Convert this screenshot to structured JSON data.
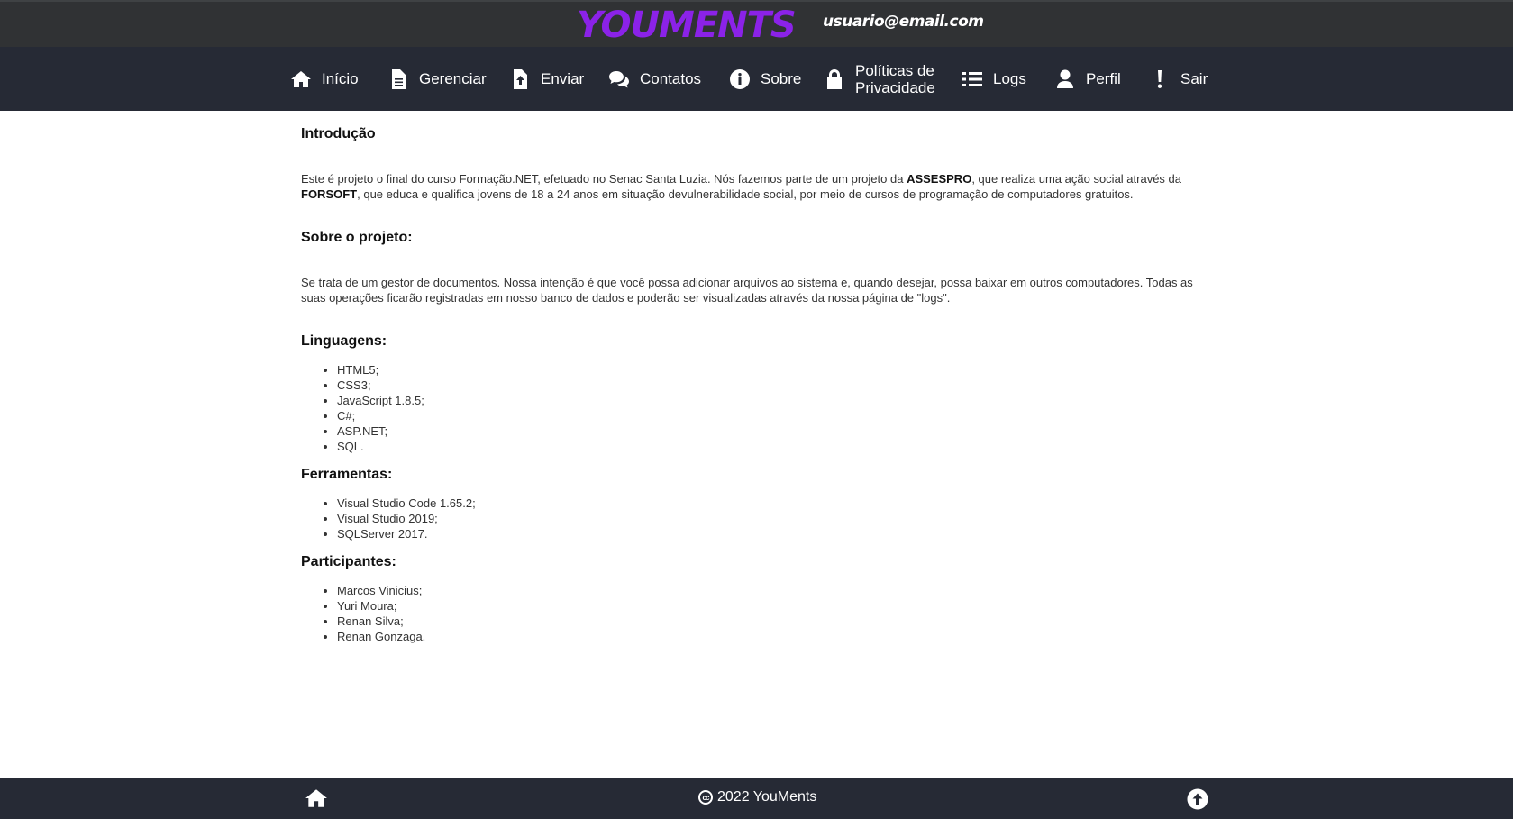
{
  "header": {
    "logo": "YOUMENTS",
    "user_email": "usuario@email.com"
  },
  "nav": {
    "items": [
      {
        "label": "Início",
        "icon": "home-icon"
      },
      {
        "label": "Gerenciar",
        "icon": "file-icon"
      },
      {
        "label": "Enviar",
        "icon": "upload-file-icon"
      },
      {
        "label": "Contatos",
        "icon": "comments-icon"
      },
      {
        "label": "Sobre",
        "icon": "info-icon"
      },
      {
        "label": "Políticas de Privacidade",
        "icon": "lock-icon"
      },
      {
        "label": "Logs",
        "icon": "list-icon"
      },
      {
        "label": "Perfil",
        "icon": "user-icon"
      },
      {
        "label": "Sair",
        "icon": "exclamation-icon"
      }
    ]
  },
  "main": {
    "intro_title": "Introdução",
    "intro_text_1": "Este é projeto o final do curso Formação.NET, efetuado no Senac Santa Luzia. Nós fazemos parte de um projeto da ",
    "intro_bold_1": "ASSESPRO",
    "intro_text_2": ", que realiza uma ação social através da ",
    "intro_bold_2": "FORSOFT",
    "intro_text_3": ", que educa e qualifica jovens de 18 a 24 anos em situação devulnerabilidade social, por meio de cursos de programação de computadores gratuitos.",
    "project_title": "Sobre o projeto:",
    "project_text": "Se trata de um gestor de documentos. Nossa intenção é que você possa adicionar arquivos ao sistema e, quando desejar, possa baixar em outros computadores. Todas as suas operações ficarão registradas em nosso banco de dados e poderão ser visualizadas através da nossa página de \"logs\".",
    "languages_title": "Linguagens:",
    "languages": [
      "HTML5;",
      "CSS3;",
      "JavaScript 1.8.5;",
      "C#;",
      "ASP.NET;",
      "SQL."
    ],
    "tools_title": "Ferramentas:",
    "tools": [
      "Visual Studio Code 1.65.2;",
      "Visual Studio 2019;",
      "SQLServer 2017."
    ],
    "participants_title": "Participantes:",
    "participants": [
      "Marcos Vinicius;",
      "Yuri Moura;",
      "Renan Silva;",
      "Renan Gonzaga."
    ]
  },
  "footer": {
    "copyright": "2022 YouMents",
    "cc_symbol": "cc"
  },
  "colors": {
    "brand": "#8b22e8",
    "topbar": "#303234",
    "navbar": "#262a35"
  }
}
